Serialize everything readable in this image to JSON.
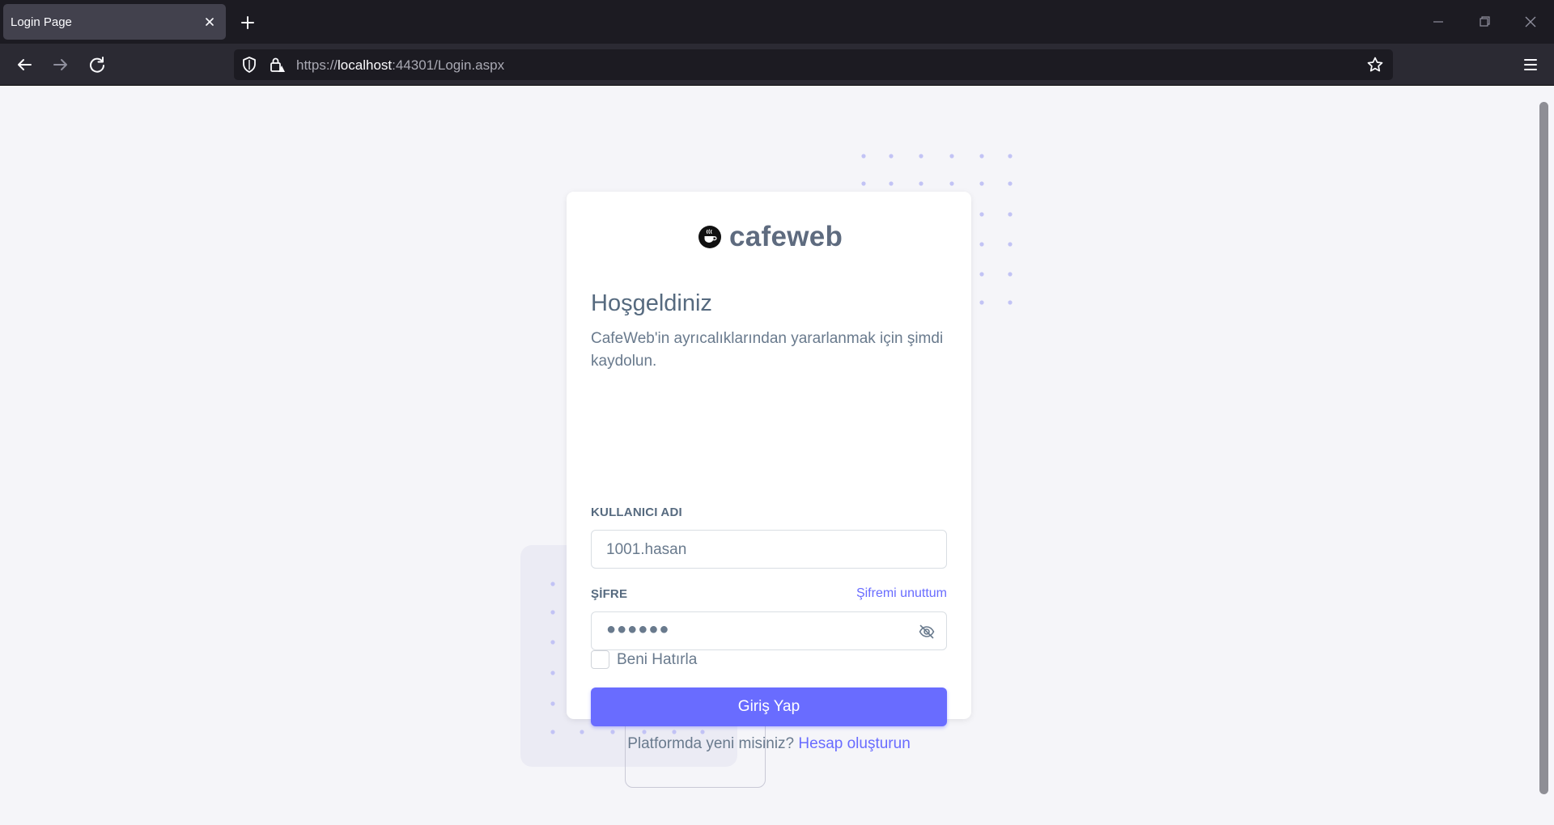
{
  "browser": {
    "tab_title": "Login Page",
    "url_scheme": "https://",
    "url_host": "localhost",
    "url_rest": ":44301/Login.aspx"
  },
  "brand": {
    "name": "cafeweb"
  },
  "login": {
    "heading": "Hoşgeldiniz",
    "subtitle": "CafeWeb'in ayrıcalıklarından yararlanmak için şimdi kaydolun.",
    "username_label": "KULLANICI ADI",
    "username_value": "1001.hasan",
    "password_label": "ŞİFRE",
    "forgot_link": "Şifremi unuttum",
    "password_masked": "●●●●●●",
    "remember_label": "Beni Hatırla",
    "submit_label": "Giriş Yap",
    "new_prompt": "Platformda yeni misiniz?",
    "create_account_link": "Hesap oluşturun"
  },
  "colors": {
    "accent": "#696cff",
    "text": "#697a8d",
    "heading": "#566a7f",
    "browser_dark": "#1c1b22"
  },
  "icons": {
    "tab_close": "close-icon",
    "new_tab": "plus-icon",
    "back": "arrow-left-icon",
    "forward": "arrow-right-icon",
    "reload": "reload-icon",
    "shield": "shield-icon",
    "lock": "lock-warning-icon",
    "bookmark": "star-icon",
    "menu": "hamburger-menu-icon",
    "password_toggle": "eye-off-icon",
    "logo": "coffee-cup-icon"
  }
}
